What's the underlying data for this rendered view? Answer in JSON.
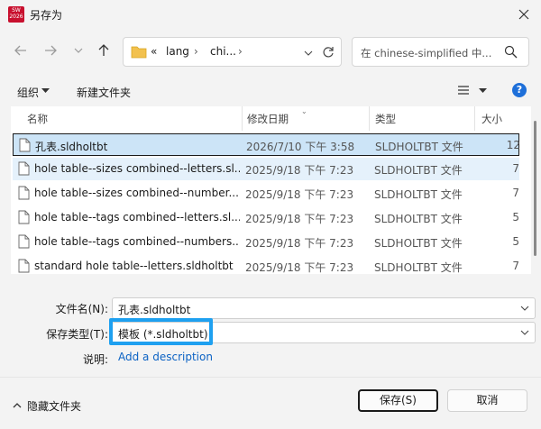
{
  "window": {
    "title": "另存为",
    "app_icon_text": "SW\n2026"
  },
  "nav": {
    "breadcrumb_prefix": "«",
    "breadcrumb": [
      "lang",
      "chi..."
    ],
    "search_placeholder": "在 chinese-simplified 中..."
  },
  "toolbar": {
    "organize": "组织",
    "new_folder": "新建文件夹"
  },
  "columns": {
    "name": "名称",
    "date": "修改日期",
    "type": "类型",
    "size": "大小"
  },
  "files": [
    {
      "name": "孔表.sldholtbt",
      "date": "2026/7/10 下午 3:58",
      "type": "SLDHOLTBT 文件",
      "size": "12"
    },
    {
      "name": "hole table--sizes combined--letters.sl...",
      "date": "2025/9/18 下午 7:23",
      "type": "SLDHOLTBT 文件",
      "size": "7"
    },
    {
      "name": "hole table--sizes combined--number...",
      "date": "2025/9/18 下午 7:23",
      "type": "SLDHOLTBT 文件",
      "size": "7"
    },
    {
      "name": "hole table--tags combined--letters.sl...",
      "date": "2025/9/18 下午 7:23",
      "type": "SLDHOLTBT 文件",
      "size": "5"
    },
    {
      "name": "hole table--tags combined--numbers...",
      "date": "2025/9/18 下午 7:23",
      "type": "SLDHOLTBT 文件",
      "size": "5"
    },
    {
      "name": "standard hole table--letters.sldholtbt",
      "date": "2025/9/18 下午 7:23",
      "type": "SLDHOLTBT 文件",
      "size": "7"
    }
  ],
  "form": {
    "filename_label": "文件名(N):",
    "filename_value": "孔表.sldholtbt",
    "type_label": "保存类型(T):",
    "type_value": "模板 (*.sldholtbt)",
    "desc_label": "说明:",
    "desc_link": "Add a description"
  },
  "footer": {
    "hide_folders": "隐藏文件夹",
    "save": "保存(S)",
    "cancel": "取消"
  },
  "colors": {
    "accent": "#1ea0f0",
    "selection": "#cce4f7",
    "link": "#0b62c4"
  }
}
